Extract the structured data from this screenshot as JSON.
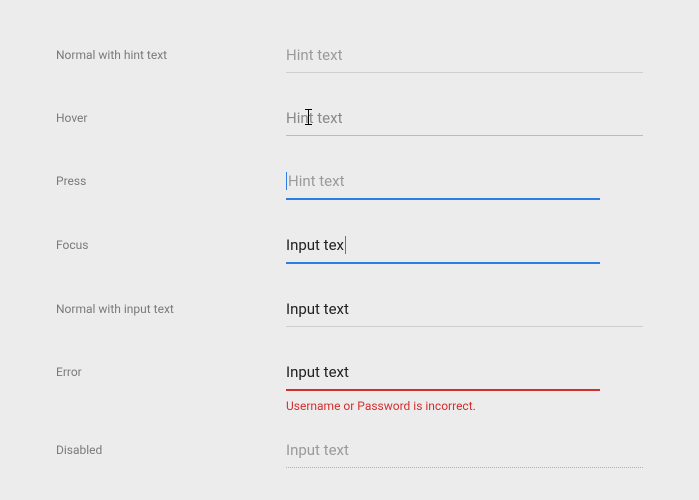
{
  "colors": {
    "focus": "#2a7eea",
    "error": "#d32f2f",
    "text": "#212121",
    "placeholder": "#9a9a9a",
    "label": "#7a7a7a",
    "background": "#ececec"
  },
  "rows": {
    "normal_hint": {
      "label": "Normal with hint text",
      "placeholder": "Hint text"
    },
    "hover": {
      "label": "Hover",
      "placeholder": "Hint text"
    },
    "press": {
      "label": "Press",
      "placeholder": "Hint text"
    },
    "focus": {
      "label": "Focus",
      "value": "Input tex"
    },
    "normal_input": {
      "label": "Normal with input text",
      "value": "Input text"
    },
    "error": {
      "label": "Error",
      "value": "Input text",
      "message": "Username or Password is incorrect."
    },
    "disabled": {
      "label": "Disabled",
      "value": "Input text"
    }
  }
}
